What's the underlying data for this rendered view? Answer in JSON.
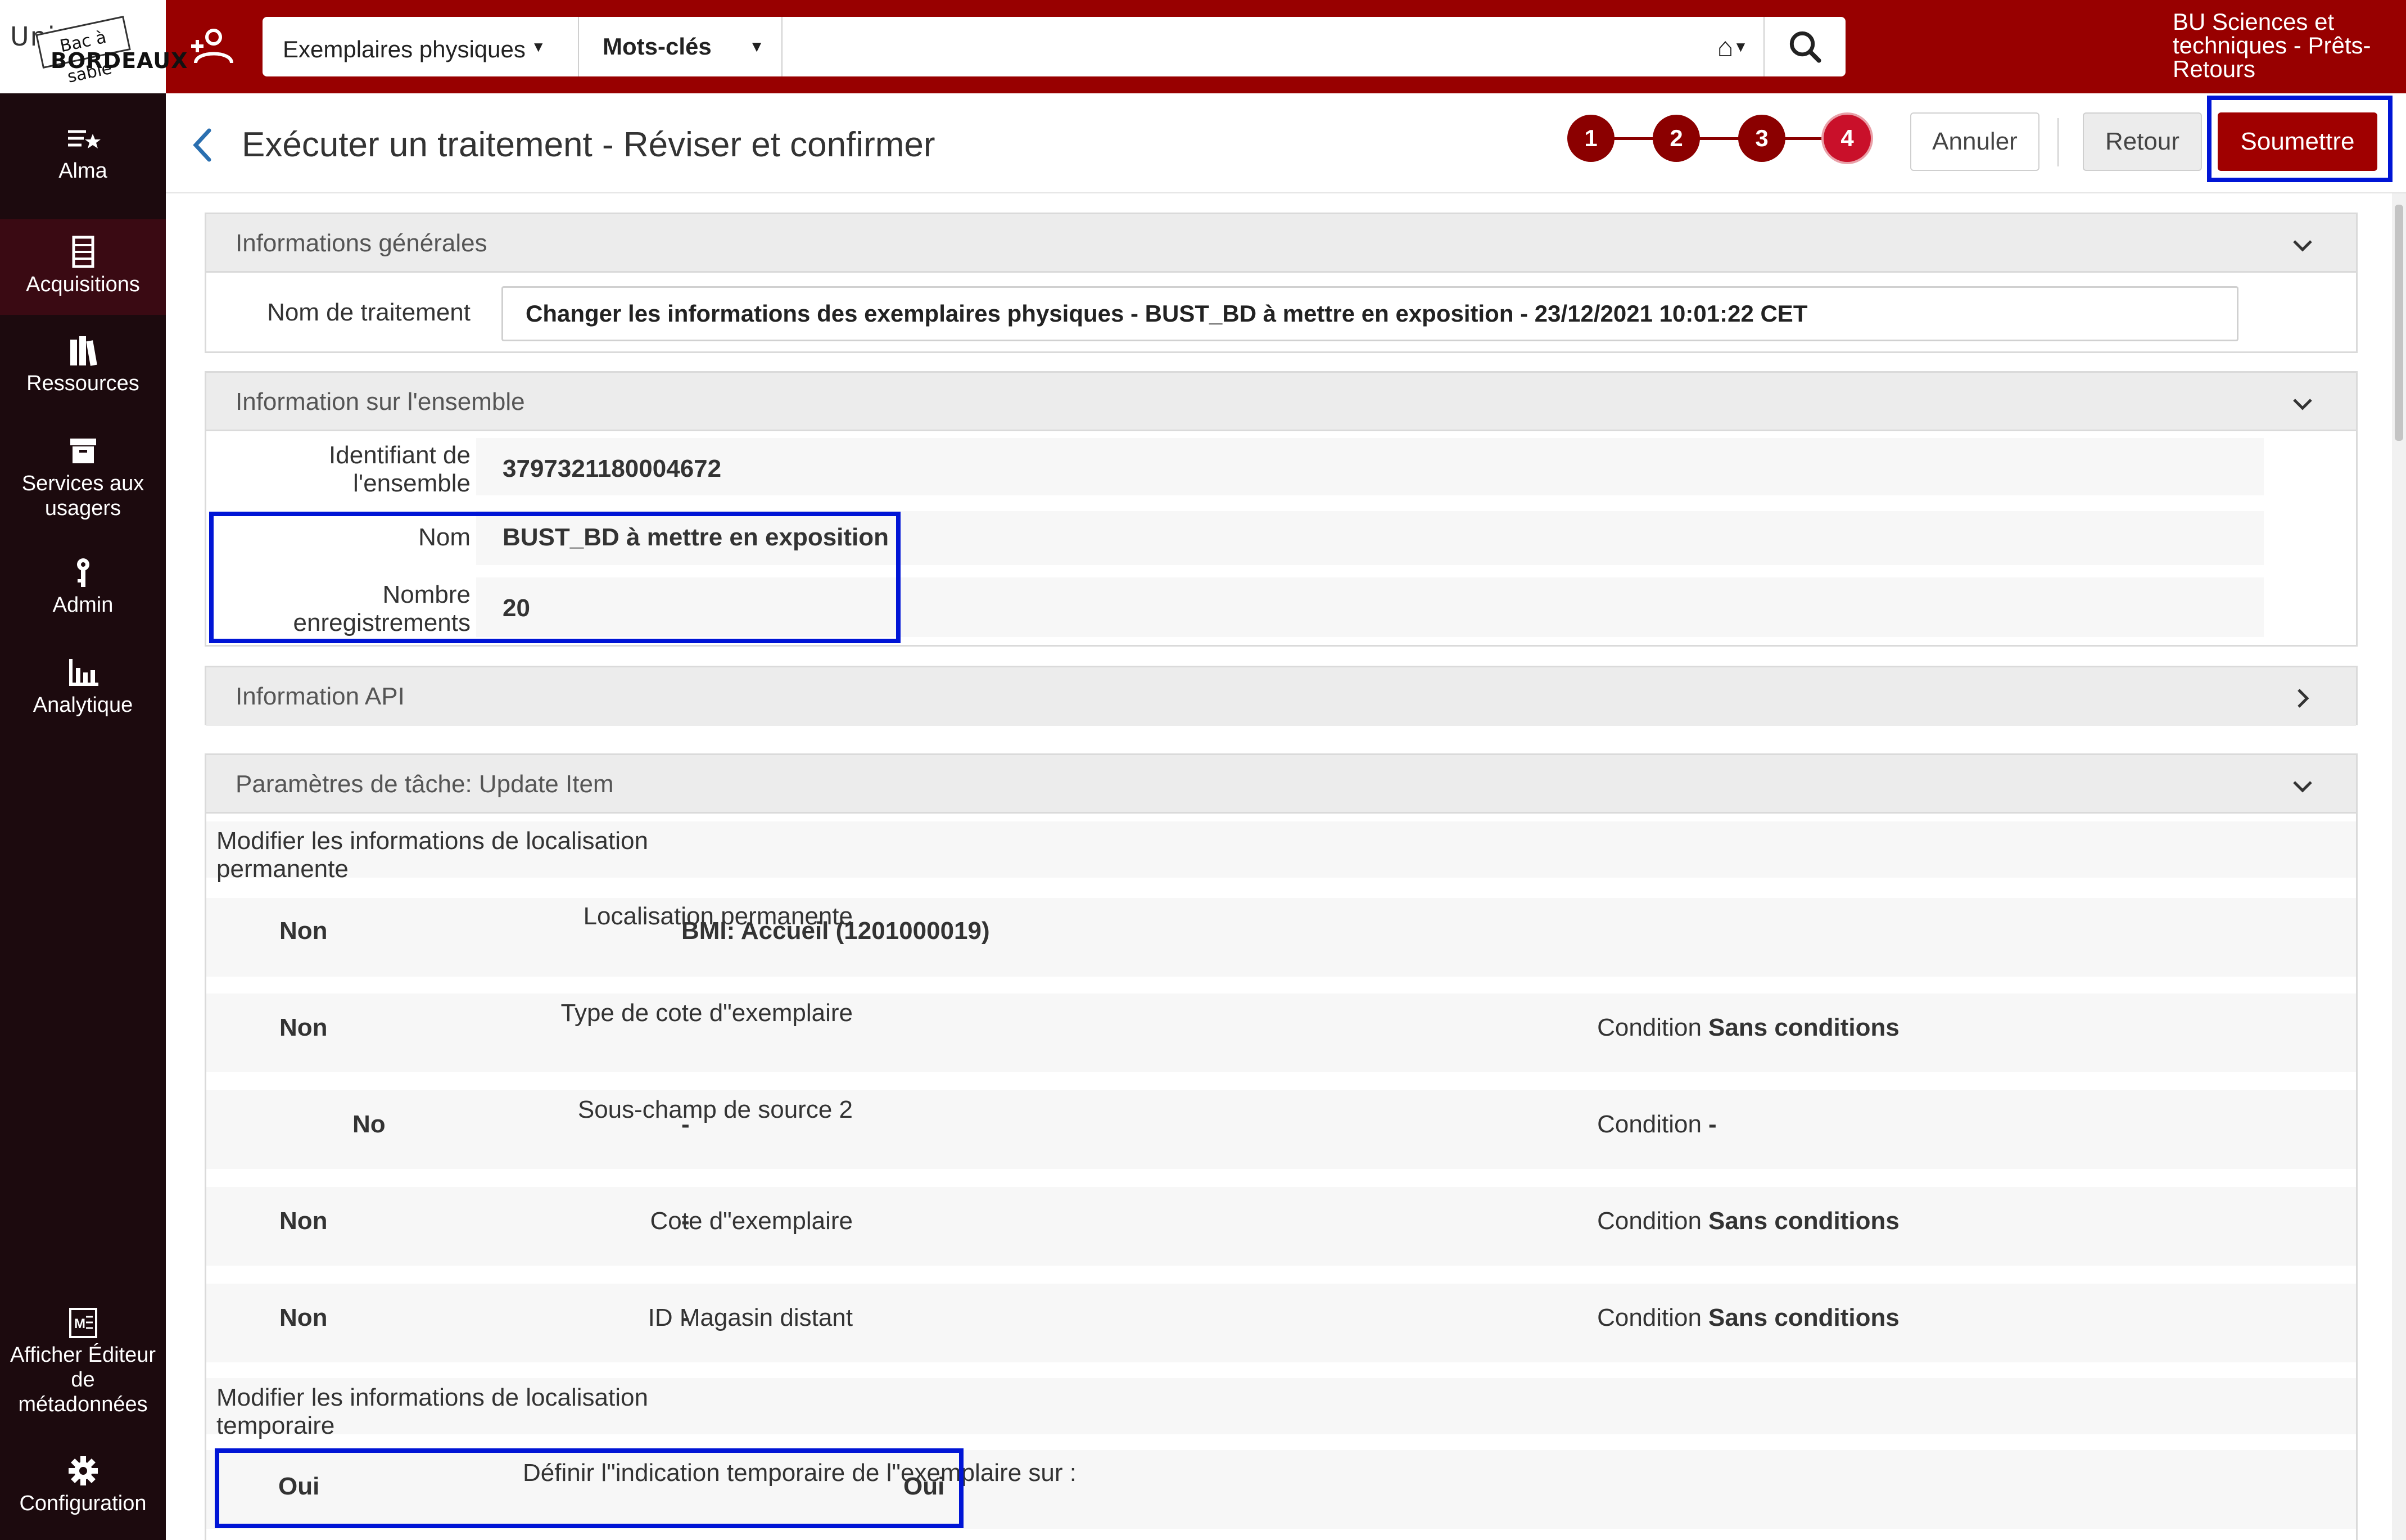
{
  "logo": {
    "line1": "Unive",
    "stamp": "Bac à sable",
    "line2": "BORDEAUX"
  },
  "topbar": {
    "scope": "Exemplaires physiques",
    "field": "Mots-clés",
    "search_value": "",
    "institution": "BU Sciences et techniques - Prêts-Retours"
  },
  "nav": {
    "items": [
      {
        "label": "Alma",
        "icon": "alma-star-icon"
      },
      {
        "label": "Acquisitions",
        "icon": "acquisitions-icon"
      },
      {
        "label": "Ressources",
        "icon": "books-icon"
      },
      {
        "label": "Services aux usagers",
        "icon": "archive-box-icon"
      },
      {
        "label": "Admin",
        "icon": "key-icon"
      },
      {
        "label": "Analytique",
        "icon": "bar-chart-icon"
      },
      {
        "label": "Afficher Éditeur de métadonnées",
        "icon": "metadata-editor-icon"
      },
      {
        "label": "Configuration",
        "icon": "gear-icon"
      }
    ]
  },
  "header": {
    "title": "Exécuter un traitement - Réviser et confirmer",
    "steps": [
      "1",
      "2",
      "3",
      "4"
    ],
    "cancel": "Annuler",
    "back": "Retour",
    "submit": "Soumettre"
  },
  "general": {
    "title": "Informations générales",
    "job_name_label": "Nom de traitement",
    "job_name_value": "Changer les informations des exemplaires physiques - BUST_BD à mettre en exposition - 23/12/2021 10:01:22 CET"
  },
  "set": {
    "title": "Information sur l'ensemble",
    "id_label": "Identifiant de l'ensemble",
    "id_value": "3797321180004672",
    "name_label": "Nom",
    "name_value": "BUST_BD à mettre en exposition",
    "count_label": "Nombre enregistrements",
    "count_value": "20"
  },
  "api": {
    "title": "Information API"
  },
  "task": {
    "title": "Paramètres de tâche: Update Item",
    "perm_section": "Modifier les informations de localisation permanente",
    "rows": [
      {
        "flag": "Non",
        "label": "Localisation permanente",
        "value": "BMI: Accueil (1201000019)",
        "cond_label": "",
        "cond_value": ""
      },
      {
        "flag": "Non",
        "label": "Type de cote d\"exemplaire",
        "value": "",
        "cond_label": "Condition",
        "cond_value": "Sans conditions"
      },
      {
        "flag": "No",
        "label": "Sous-champ de source 2",
        "value": "-",
        "cond_label": "Condition",
        "cond_value": "-"
      },
      {
        "flag": "Non",
        "label": "Cote d\"exemplaire",
        "value": "-",
        "cond_label": "Condition",
        "cond_value": "Sans conditions"
      },
      {
        "flag": "Non",
        "label": "ID Magasin distant",
        "value": "-",
        "cond_label": "Condition",
        "cond_value": "Sans conditions"
      }
    ],
    "temp_section": "Modifier les informations de localisation temporaire",
    "temp_row": {
      "flag": "Oui",
      "label": "Définir l\"indication temporaire de l\"exemplaire sur :",
      "value": "Oui"
    }
  },
  "colors": {
    "brand": "#980000",
    "nav_bg": "#1c0a0e",
    "highlight": "#0015d6",
    "submit": "#a00000"
  }
}
